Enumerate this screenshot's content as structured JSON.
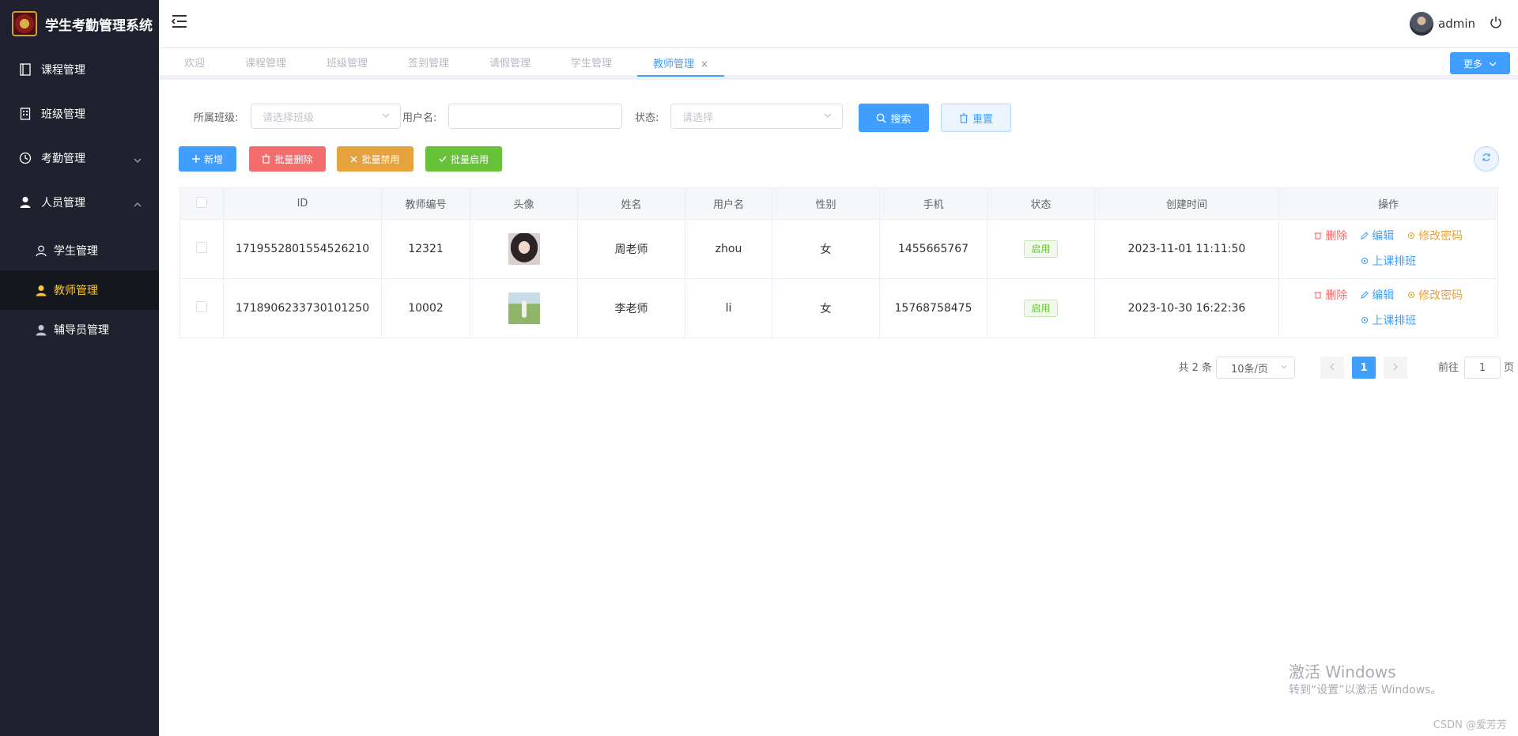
{
  "app": {
    "title": "学生考勤管理系统"
  },
  "sidebar": {
    "items": [
      {
        "label": "课程管理",
        "icon": "book-icon"
      },
      {
        "label": "班级管理",
        "icon": "building-icon"
      },
      {
        "label": "考勤管理",
        "icon": "clock-icon"
      },
      {
        "label": "人员管理",
        "icon": "user-icon"
      }
    ],
    "submenu": [
      {
        "label": "学生管理",
        "icon": "user-outline-icon"
      },
      {
        "label": "教师管理",
        "icon": "user-solid-icon",
        "active": true
      },
      {
        "label": "辅导员管理",
        "icon": "user-solid-icon"
      }
    ]
  },
  "header": {
    "username": "admin"
  },
  "tabs": {
    "items": [
      "欢迎",
      "课程管理",
      "班级管理",
      "签到管理",
      "请假管理",
      "学生管理",
      "教师管理"
    ],
    "active_close": "×",
    "more_label": "更多"
  },
  "filters": {
    "class_label": "所属班级:",
    "class_placeholder": "请选择班级",
    "username_label": "用户名:",
    "username_value": "",
    "status_label": "状态:",
    "status_placeholder": "请选择",
    "search_label": "搜索",
    "reset_label": "重置"
  },
  "toolbar": {
    "add_label": "新增",
    "batch_delete_label": "批量删除",
    "batch_disable_label": "批量禁用",
    "batch_enable_label": "批量启用"
  },
  "table": {
    "headers": [
      "ID",
      "教师编号",
      "头像",
      "姓名",
      "用户名",
      "性别",
      "手机",
      "状态",
      "创建时间",
      "操作"
    ],
    "rows": [
      {
        "id": "1719552801554526210",
        "teacher_no": "12321",
        "name": "周老师",
        "username": "zhou",
        "gender": "女",
        "phone": "1455665767",
        "status": "启用",
        "created": "2023-11-01 11:11:50"
      },
      {
        "id": "1718906233730101250",
        "teacher_no": "10002",
        "name": "李老师",
        "username": "li",
        "gender": "女",
        "phone": "15768758475",
        "status": "启用",
        "created": "2023-10-30 16:22:36"
      }
    ],
    "ops": {
      "delete": "删除",
      "edit": "编辑",
      "change_password": "修改密码",
      "schedule": "上课排班"
    }
  },
  "pagination": {
    "total_text": "共 2 条",
    "page_size": "10条/页",
    "current_page": "1",
    "goto_prefix": "前往",
    "goto_value": "1",
    "goto_suffix": "页"
  },
  "watermark": {
    "line1": "激活 Windows",
    "line2": "转到“设置”以激活 Windows。",
    "credit": "CSDN @爱芳芳"
  },
  "colors": {
    "primary": "#409eff",
    "danger": "#f56c6c",
    "warning": "#e6a23c",
    "success": "#67c23a",
    "sidebar_bg": "#1f222e",
    "active_text": "#ffc72c"
  }
}
